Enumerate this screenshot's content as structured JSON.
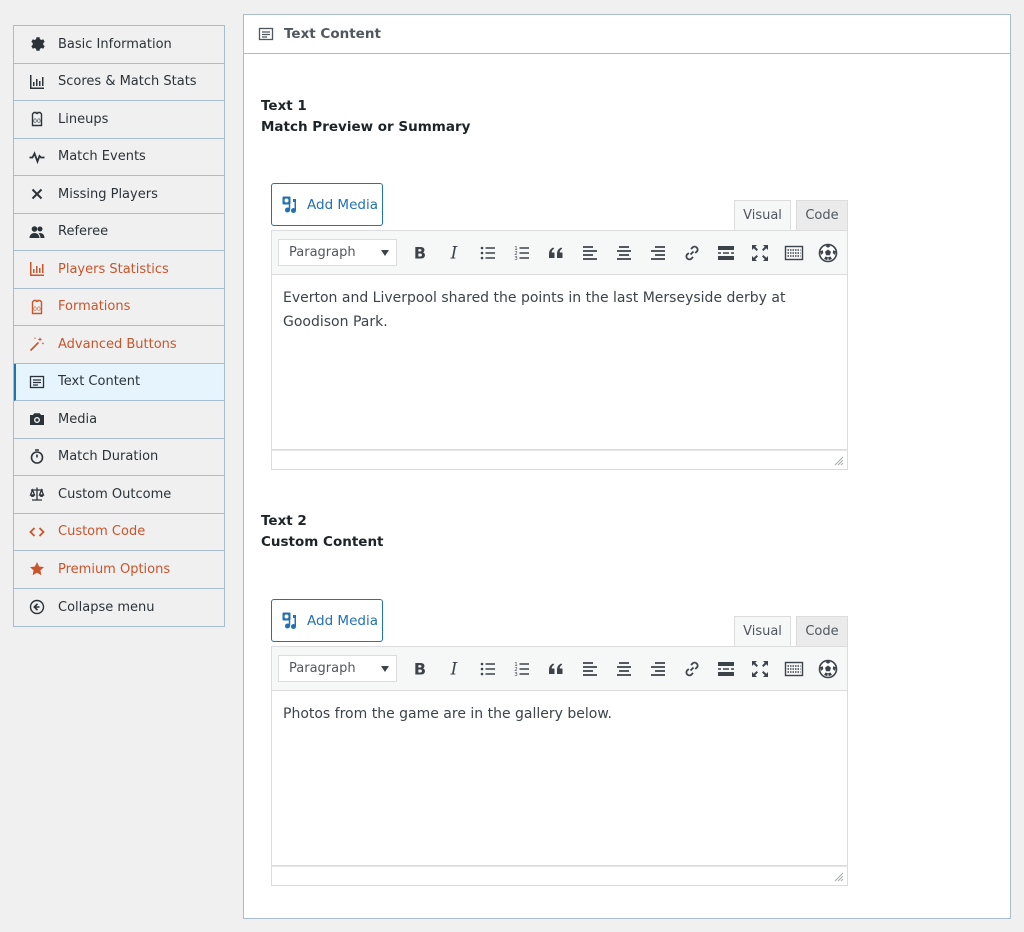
{
  "sidebar": {
    "items": [
      {
        "label": "Basic Information",
        "icon": "gear-icon"
      },
      {
        "label": "Scores & Match Stats",
        "icon": "bar-chart-icon"
      },
      {
        "label": "Lineups",
        "icon": "jersey-icon"
      },
      {
        "label": "Match Events",
        "icon": "pulse-icon"
      },
      {
        "label": "Missing Players",
        "icon": "x-icon"
      },
      {
        "label": "Referee",
        "icon": "people-icon"
      },
      {
        "label": "Players Statistics",
        "icon": "bar-chart-icon"
      },
      {
        "label": "Formations",
        "icon": "jersey-icon"
      },
      {
        "label": "Advanced Buttons",
        "icon": "magic-wand-icon"
      },
      {
        "label": "Text Content",
        "icon": "text-icon"
      },
      {
        "label": "Media",
        "icon": "camera-icon"
      },
      {
        "label": "Match Duration",
        "icon": "stopwatch-icon"
      },
      {
        "label": "Custom Outcome",
        "icon": "scales-icon"
      },
      {
        "label": "Custom Code",
        "icon": "code-icon"
      },
      {
        "label": "Premium Options",
        "icon": "star-icon"
      },
      {
        "label": "Collapse menu",
        "icon": "collapse-icon"
      }
    ]
  },
  "panel": {
    "title": "Text Content",
    "editors": [
      {
        "label_line1": "Text 1",
        "label_line2": "Match Preview or Summary",
        "add_media": "Add Media",
        "tab_visual": "Visual",
        "tab_code": "Code",
        "format": "Paragraph",
        "content": "Everton and Liverpool shared the points in the last Merseyside derby at Goodison Park."
      },
      {
        "label_line1": "Text 2",
        "label_line2": "Custom Content",
        "add_media": "Add Media",
        "tab_visual": "Visual",
        "tab_code": "Code",
        "format": "Paragraph",
        "content": "Photos from the game are in the gallery below."
      }
    ]
  },
  "colors": {
    "accent": "#2271b1",
    "premium": "#c9552b",
    "active_bg": "#e6f4fd"
  }
}
